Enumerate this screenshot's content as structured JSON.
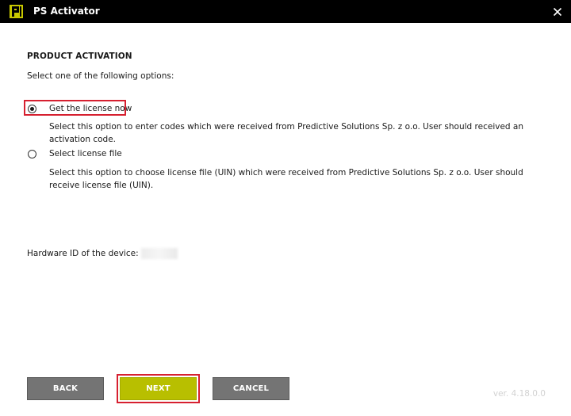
{
  "window": {
    "title": "PS Activator",
    "logo_icon": "ps-activator-logo-icon",
    "close_icon": "close-icon",
    "accent_color": "#b8bf00",
    "highlight_color": "#d62030"
  },
  "activation": {
    "section_title": "PRODUCT ACTIVATION",
    "instruction": "Select one of the following options:",
    "options": [
      {
        "label": "Get the license now",
        "description": "Select this option to enter codes which were received from Predictive Solutions Sp. z o.o. User should received an activation code.",
        "selected": true
      },
      {
        "label": "Select license file",
        "description": "Select this option to choose license file (UIN) which were received from Predictive Solutions Sp. z o.o. User should receive license file (UIN).",
        "selected": false
      }
    ],
    "hardware_id_label": "Hardware ID of the device:"
  },
  "footer": {
    "back_label": "BACK",
    "next_label": "NEXT",
    "cancel_label": "CANCEL",
    "version": "ver. 4.18.0.0"
  }
}
